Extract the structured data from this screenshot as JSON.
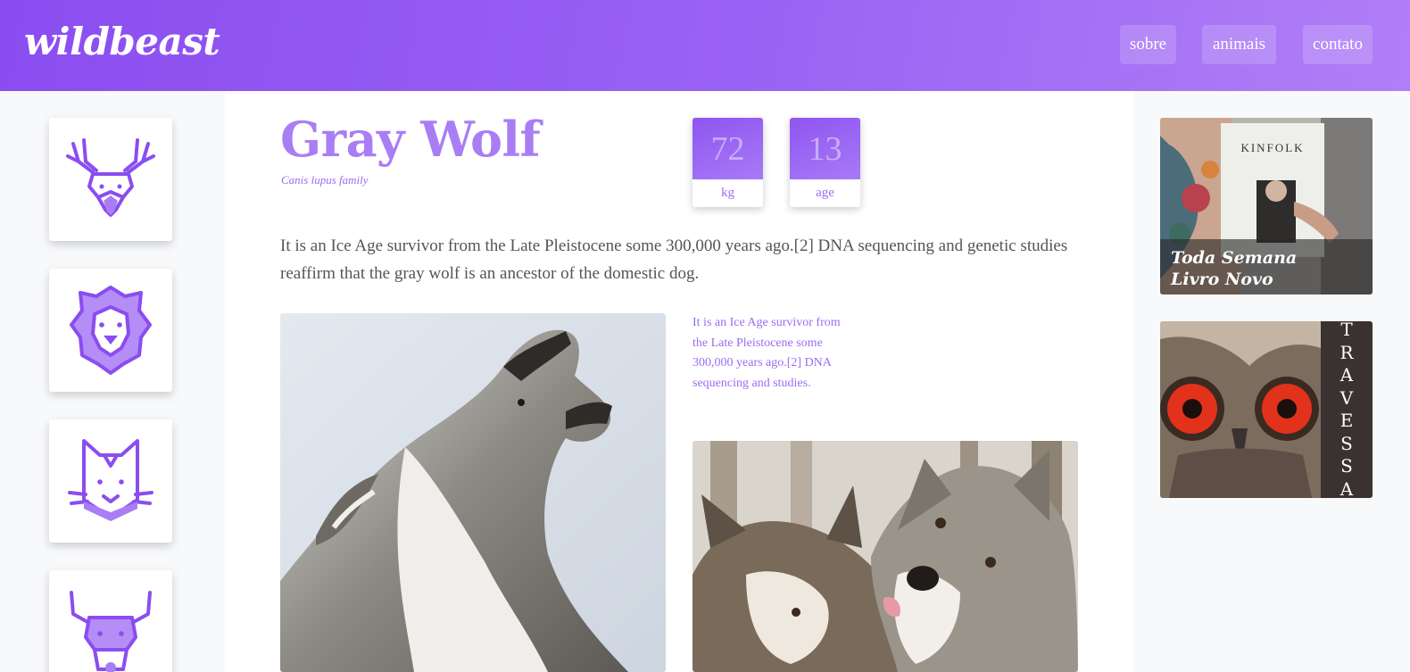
{
  "header": {
    "logo": "wildbeast",
    "nav": [
      "sobre",
      "animais",
      "contato"
    ]
  },
  "sidebar": {
    "animals": [
      {
        "icon": "deer-icon"
      },
      {
        "icon": "lion-icon"
      },
      {
        "icon": "cat-icon"
      },
      {
        "icon": "bull-icon"
      }
    ]
  },
  "main": {
    "title": "Gray Wolf",
    "subtitle": "Canis lupus family",
    "stats": [
      {
        "value": "72",
        "label": "kg"
      },
      {
        "value": "13",
        "label": "age"
      }
    ],
    "intro": "It is an Ice Age survivor from the Late Pleistocene some 300,000 years ago.[2] DNA sequencing and genetic studies reaffirm that the gray wolf is an ancestor of the domestic dog.",
    "sidenote": "It is an Ice Age survivor from the Late Pleistocene some 300,000 years ago.[2] DNA sequencing and studies.",
    "photos": [
      "howling-wolf-photo",
      "two-wolves-photo"
    ]
  },
  "ads": [
    {
      "book_title": "KINFOLK",
      "caption_line1": "Toda Semana",
      "caption_line2": "Livro Novo"
    },
    {
      "vertical_text": [
        "T",
        "R",
        "A",
        "V",
        "E",
        "S",
        "S",
        "A"
      ]
    }
  ],
  "colors": {
    "accent": "#9b6cf0",
    "header_start": "#8a4df0",
    "header_end": "#b07ff7",
    "sidebar_bg": "#f8f9fb"
  }
}
